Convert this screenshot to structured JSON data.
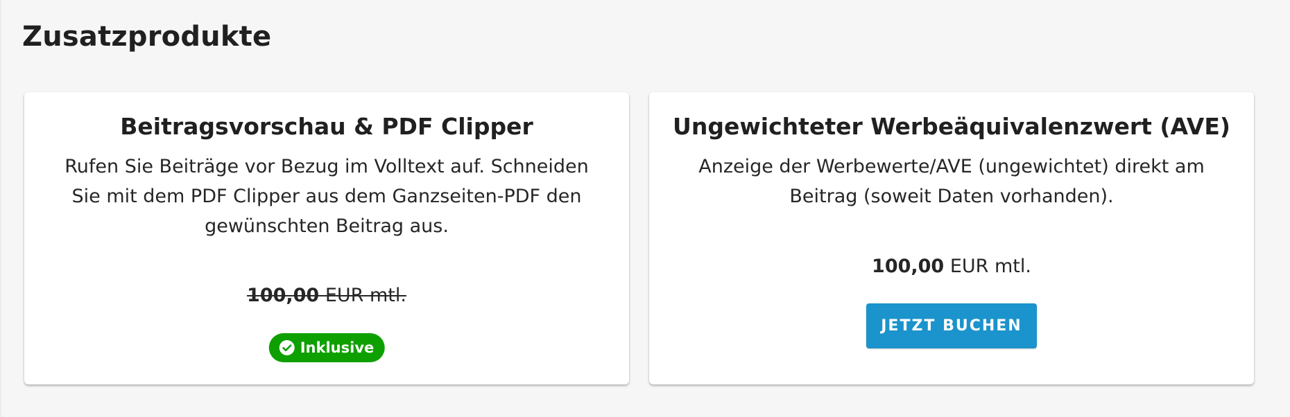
{
  "section": {
    "title": "Zusatzprodukte"
  },
  "products": [
    {
      "title": "Beitragsvorschau & PDF Clipper",
      "description": "Rufen Sie Beiträge vor Bezug im Volltext auf. Schneiden Sie mit dem PDF Clipper aus dem Ganzseiten-PDF den gewünschten Beitrag aus.",
      "price_amount": "100,00",
      "price_unit": " EUR mtl.",
      "price_struck": true,
      "badge": {
        "label": "Inklusive",
        "icon": "check-circle-icon",
        "color": "#0ea000"
      }
    },
    {
      "title": "Ungewichteter Werbeäquivalenzwert (AVE)",
      "description": "Anzeige der Werbewerte/AVE (ungewichtet) direkt am Beitrag (soweit Daten vorhanden).",
      "price_amount": "100,00",
      "price_unit": " EUR mtl.",
      "price_struck": false,
      "button": {
        "label": "JETZT BUCHEN",
        "color": "#1b93cc"
      }
    }
  ],
  "colors": {
    "background": "#f6f6f6",
    "card": "#ffffff",
    "accent_button": "#1b93cc",
    "included_badge": "#0ea000"
  }
}
